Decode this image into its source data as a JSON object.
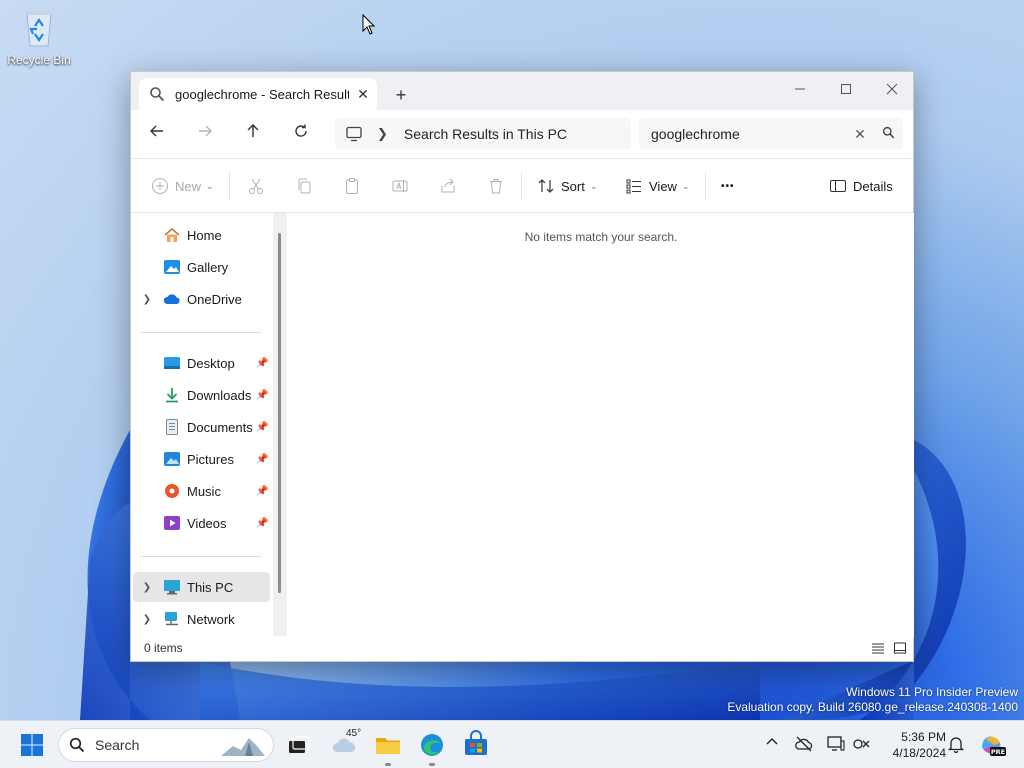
{
  "desktop": {
    "recycle_bin_label": "Recycle Bin"
  },
  "watermark": {
    "line1": "Windows 11 Pro Insider Preview",
    "line2": "Evaluation copy. Build 26080.ge_release.240308-1400"
  },
  "window": {
    "tab_title": "googlechrome - Search Result",
    "tab_close": "✕",
    "new_tab": "+",
    "address": {
      "breadcrumb": "Search Results in This PC"
    },
    "search": {
      "value": "googlechrome",
      "clear": "✕"
    },
    "toolbar": {
      "new_label": "New",
      "sort_label": "Sort",
      "view_label": "View",
      "more_label": "•••",
      "details_label": "Details"
    },
    "sidebar": {
      "quick": [
        {
          "label": "Home"
        },
        {
          "label": "Gallery"
        },
        {
          "label": "OneDrive"
        }
      ],
      "pinned": [
        {
          "label": "Desktop"
        },
        {
          "label": "Downloads"
        },
        {
          "label": "Documents"
        },
        {
          "label": "Pictures"
        },
        {
          "label": "Music"
        },
        {
          "label": "Videos"
        }
      ],
      "devices": [
        {
          "label": "This PC"
        },
        {
          "label": "Network"
        }
      ]
    },
    "content": {
      "empty_message": "No items match your search."
    },
    "status": {
      "item_count": "0 items"
    }
  },
  "taskbar": {
    "search_label": "Search",
    "weather_temp": "45°",
    "clock_time": "5:36 PM",
    "clock_date": "4/18/2024"
  },
  "colors": {
    "accent": "#0067c0",
    "folder": "#f4c034",
    "window_bg": "#ffffff"
  }
}
